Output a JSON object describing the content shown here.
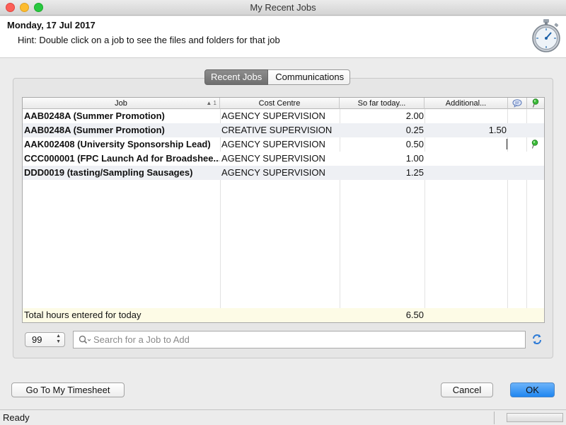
{
  "window": {
    "title": "My Recent Jobs"
  },
  "header": {
    "date": "Monday, 17 Jul 2017",
    "hint": "Hint: Double click on a job to see the files and folders for that job",
    "icon": "stopwatch-icon"
  },
  "tabs": [
    {
      "label": "Recent Jobs",
      "selected": true
    },
    {
      "label": "Communications",
      "selected": false
    }
  ],
  "table": {
    "columns": {
      "job": "Job",
      "sort_indicator": "1",
      "cost_centre": "Cost Centre",
      "so_far": "So far today...",
      "additional": "Additional...",
      "notes_icon": "speech-bubble-icon",
      "pin_icon": "green-pin-icon"
    },
    "rows": [
      {
        "job": "AAB0248A (Summer Promotion)",
        "cost_centre": "AGENCY SUPERVISION",
        "so_far": "2.00",
        "additional": "",
        "pinned": false
      },
      {
        "job": "AAB0248A (Summer Promotion)",
        "cost_centre": "CREATIVE SUPERVISION",
        "so_far": "0.25",
        "additional": "1.50",
        "pinned": false
      },
      {
        "job": "AAK002408 (University Sponsorship Lead)",
        "cost_centre": "AGENCY SUPERVISION",
        "so_far": "0.50",
        "additional": "",
        "pinned": true
      },
      {
        "job": "CCC000001 (FPC Launch Ad for Broadshee...",
        "cost_centre": "AGENCY SUPERVISION",
        "so_far": "1.00",
        "additional": "",
        "pinned": false
      },
      {
        "job": "DDD0019 (tasting/Sampling Sausages)",
        "cost_centre": "AGENCY SUPERVISION",
        "so_far": "1.25",
        "additional": "",
        "pinned": false
      }
    ],
    "total": {
      "label": "Total hours entered for today",
      "value": "6.50"
    }
  },
  "controls": {
    "count_value": "99",
    "search_placeholder": "Search for a Job to Add",
    "refresh_icon": "refresh-icon"
  },
  "buttons": {
    "timesheet": "Go To My Timesheet",
    "cancel": "Cancel",
    "ok": "OK"
  },
  "status": {
    "text": "Ready"
  },
  "colors": {
    "accent": "#1f86f0",
    "total_row": "#fdfbe6",
    "tab_selected": "#6f6f6f"
  }
}
